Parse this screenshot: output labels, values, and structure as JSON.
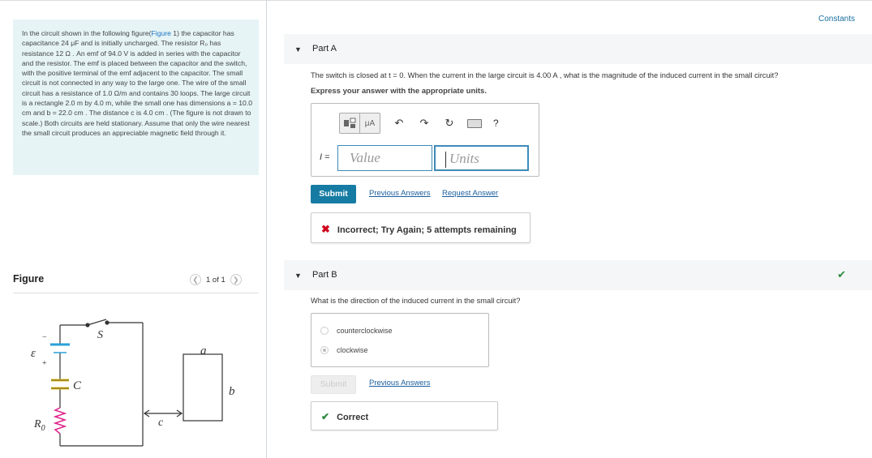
{
  "problem": {
    "text_before_link": "In the circuit shown in the following figure(",
    "figure_link": "Figure",
    "text_after_link": " 1) the capacitor has capacitance 24 μF and is initially uncharged. The resistor R₀ has resistance 12 Ω . An emf of 94.0 V is added in series with the capacitor and the resistor. The emf is placed between the capacitor and the switch, with the positive terminal of the emf adjacent to the capacitor. The small circuit is not connected in any way to the large one. The wire of the small circuit has a resistance of 1.0 Ω/m and contains 30 loops. The large circuit is a rectangle 2.0 m by 4.0 m, while the small one has dimensions a = 10.0 cm and b = 22.0 cm . The distance c is 4.0 cm . (The figure is not drawn to scale.) Both circuits are held stationary. Assume that only the wire nearest the small circuit produces an appreciable magnetic field through it."
  },
  "figure": {
    "title": "Figure",
    "pager": "1 of 1",
    "labels": {
      "emf": "ε",
      "minus": "−",
      "plus": "+",
      "switch": "S",
      "capacitor": "C",
      "resistor": "R",
      "resistor_sub": "0",
      "a": "a",
      "b": "b",
      "c": "c"
    }
  },
  "constants_link": "Constants",
  "part_a": {
    "label": "Part A",
    "question": "The switch is closed at t = 0. When the current in the large circuit is 4.00 A , what is the magnitude of the induced current in the small circuit?",
    "instruction": "Express your answer with the appropriate units.",
    "toolbar": {
      "unit_button": "μA",
      "help": "?"
    },
    "input_label": "I",
    "value_placeholder": "Value",
    "units_placeholder": "Units",
    "submit": "Submit",
    "previous_answers": "Previous Answers",
    "request_answer": "Request Answer",
    "feedback": "Incorrect; Try Again; 5 attempts remaining"
  },
  "part_b": {
    "label": "Part B",
    "question": "What is the direction of the induced current in the small circuit?",
    "options": [
      "counterclockwise",
      "clockwise"
    ],
    "selected": "clockwise",
    "submit": "Submit",
    "previous_answers": "Previous Answers",
    "feedback": "Correct"
  },
  "colors": {
    "accent": "#167ba3",
    "problem_bg": "#e6f4f6",
    "correct": "#2b8a3e",
    "incorrect": "#d0021b",
    "resistor": "#e0218a",
    "capacitor_blue": "#2aa0d8",
    "capacitor_yellow": "#e8c21a"
  }
}
